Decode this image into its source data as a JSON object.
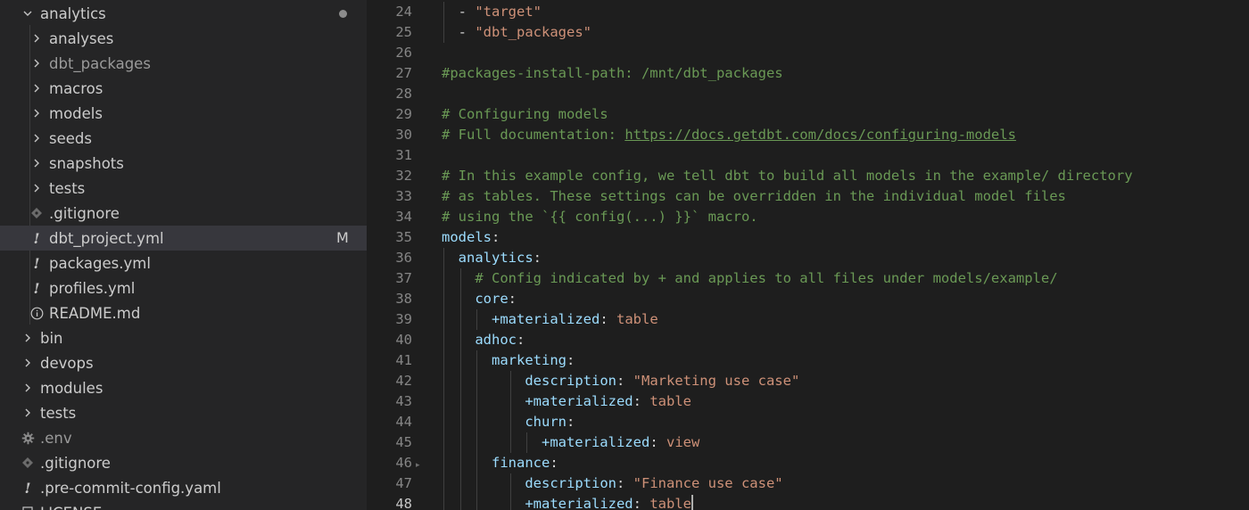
{
  "explorer": {
    "items": [
      {
        "label": "analytics",
        "icon": "chevron-down-icon",
        "depth": 0,
        "kind": "folder-open",
        "modified_dot": true
      },
      {
        "label": "analyses",
        "icon": "chevron-right-icon",
        "depth": 1,
        "kind": "folder"
      },
      {
        "label": "dbt_packages",
        "icon": "chevron-right-icon",
        "depth": 1,
        "kind": "folder",
        "dimmed": true
      },
      {
        "label": "macros",
        "icon": "chevron-right-icon",
        "depth": 1,
        "kind": "folder"
      },
      {
        "label": "models",
        "icon": "chevron-right-icon",
        "depth": 1,
        "kind": "folder"
      },
      {
        "label": "seeds",
        "icon": "chevron-right-icon",
        "depth": 1,
        "kind": "folder"
      },
      {
        "label": "snapshots",
        "icon": "chevron-right-icon",
        "depth": 1,
        "kind": "folder"
      },
      {
        "label": "tests",
        "icon": "chevron-right-icon",
        "depth": 1,
        "kind": "folder"
      },
      {
        "label": ".gitignore",
        "icon": "git-diamond-icon",
        "depth": 1,
        "kind": "file"
      },
      {
        "label": "dbt_project.yml",
        "icon": "yaml-exclamation-icon",
        "depth": 1,
        "kind": "file",
        "selected": true,
        "badge": "M"
      },
      {
        "label": "packages.yml",
        "icon": "yaml-exclamation-icon",
        "depth": 1,
        "kind": "file"
      },
      {
        "label": "profiles.yml",
        "icon": "yaml-exclamation-icon",
        "depth": 1,
        "kind": "file"
      },
      {
        "label": "README.md",
        "icon": "info-circle-icon",
        "depth": 1,
        "kind": "file"
      },
      {
        "label": "bin",
        "icon": "chevron-right-icon",
        "depth": 0,
        "kind": "folder"
      },
      {
        "label": "devops",
        "icon": "chevron-right-icon",
        "depth": 0,
        "kind": "folder"
      },
      {
        "label": "modules",
        "icon": "chevron-right-icon",
        "depth": 0,
        "kind": "folder"
      },
      {
        "label": "tests",
        "icon": "chevron-right-icon",
        "depth": 0,
        "kind": "folder"
      },
      {
        "label": ".env",
        "icon": "gear-icon",
        "depth": 0,
        "kind": "file",
        "dimmed": true
      },
      {
        "label": ".gitignore",
        "icon": "git-diamond-icon",
        "depth": 0,
        "kind": "file"
      },
      {
        "label": ".pre-commit-config.yaml",
        "icon": "yaml-exclamation-icon",
        "depth": 0,
        "kind": "file"
      },
      {
        "label": "LICENSE",
        "icon": "license-icon",
        "depth": 0,
        "kind": "file"
      }
    ]
  },
  "editor": {
    "active_line": 48,
    "lines": [
      {
        "n": 24,
        "indent": 1,
        "tokens": [
          [
            "p",
            "- "
          ],
          [
            "s",
            "\"target\""
          ]
        ]
      },
      {
        "n": 25,
        "indent": 1,
        "tokens": [
          [
            "p",
            "- "
          ],
          [
            "s",
            "\"dbt_packages\""
          ]
        ]
      },
      {
        "n": 26,
        "indent": 0,
        "tokens": []
      },
      {
        "n": 27,
        "indent": 0,
        "tokens": [
          [
            "c",
            "#packages-install-path: /mnt/dbt_packages"
          ]
        ]
      },
      {
        "n": 28,
        "indent": 0,
        "tokens": []
      },
      {
        "n": 29,
        "indent": 0,
        "tokens": [
          [
            "c",
            "# Configuring models"
          ]
        ]
      },
      {
        "n": 30,
        "indent": 0,
        "tokens": [
          [
            "c",
            "# Full documentation: "
          ],
          [
            "cu",
            "https://docs.getdbt.com/docs/configuring-models"
          ]
        ]
      },
      {
        "n": 31,
        "indent": 0,
        "tokens": []
      },
      {
        "n": 32,
        "indent": 0,
        "tokens": [
          [
            "c",
            "# In this example config, we tell dbt to build all models in the example/ directory"
          ]
        ]
      },
      {
        "n": 33,
        "indent": 0,
        "tokens": [
          [
            "c",
            "# as tables. These settings can be overridden in the individual model files"
          ]
        ]
      },
      {
        "n": 34,
        "indent": 0,
        "tokens": [
          [
            "c",
            "# using the `{{ config(...) }}` macro."
          ]
        ]
      },
      {
        "n": 35,
        "indent": 0,
        "tokens": [
          [
            "k",
            "models"
          ],
          [
            "p",
            ":"
          ]
        ]
      },
      {
        "n": 36,
        "indent": 1,
        "tokens": [
          [
            "k",
            "analytics"
          ],
          [
            "p",
            ":"
          ]
        ]
      },
      {
        "n": 37,
        "indent": 2,
        "tokens": [
          [
            "c",
            "# Config indicated by + and applies to all files under models/example/"
          ]
        ]
      },
      {
        "n": 38,
        "indent": 2,
        "tokens": [
          [
            "k",
            "core"
          ],
          [
            "p",
            ":"
          ]
        ]
      },
      {
        "n": 39,
        "indent": 3,
        "tokens": [
          [
            "k",
            "+materialized"
          ],
          [
            "p",
            ": "
          ],
          [
            "s",
            "table"
          ]
        ]
      },
      {
        "n": 40,
        "indent": 2,
        "tokens": [
          [
            "k",
            "adhoc"
          ],
          [
            "p",
            ":"
          ]
        ]
      },
      {
        "n": 41,
        "indent": 3,
        "tokens": [
          [
            "k",
            "marketing"
          ],
          [
            "p",
            ":"
          ]
        ]
      },
      {
        "n": 42,
        "indent": 5,
        "tokens": [
          [
            "k",
            "description"
          ],
          [
            "p",
            ": "
          ],
          [
            "s",
            "\"Marketing use case\""
          ]
        ]
      },
      {
        "n": 43,
        "indent": 5,
        "tokens": [
          [
            "k",
            "+materialized"
          ],
          [
            "p",
            ": "
          ],
          [
            "s",
            "table"
          ]
        ]
      },
      {
        "n": 44,
        "indent": 5,
        "tokens": [
          [
            "k",
            "churn"
          ],
          [
            "p",
            ":"
          ]
        ]
      },
      {
        "n": 45,
        "indent": 6,
        "tokens": [
          [
            "k",
            "+materialized"
          ],
          [
            "p",
            ": "
          ],
          [
            "s",
            "view"
          ]
        ]
      },
      {
        "n": 46,
        "indent": 3,
        "tokens": [
          [
            "k",
            "finance"
          ],
          [
            "p",
            ":"
          ]
        ]
      },
      {
        "n": 47,
        "indent": 5,
        "tokens": [
          [
            "k",
            "description"
          ],
          [
            "p",
            ": "
          ],
          [
            "s",
            "\"Finance use case\""
          ]
        ]
      },
      {
        "n": 48,
        "indent": 5,
        "tokens": [
          [
            "k",
            "+materialized"
          ],
          [
            "p",
            ": "
          ],
          [
            "s",
            "table"
          ]
        ]
      }
    ]
  }
}
